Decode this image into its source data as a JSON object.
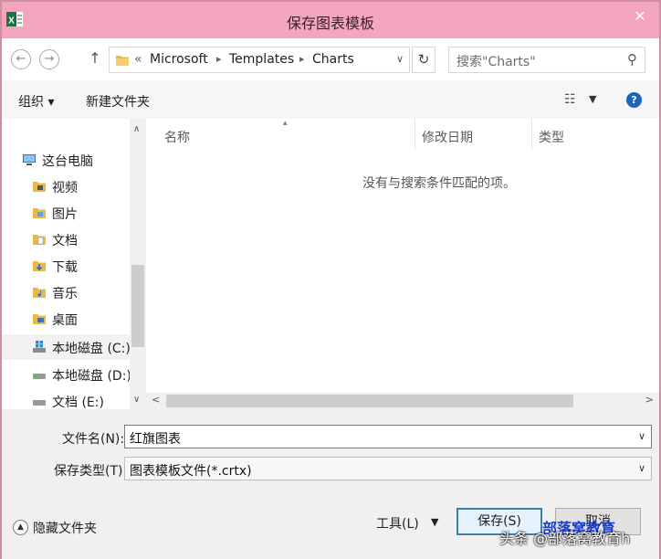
{
  "window": {
    "title": "保存图表模板",
    "close_glyph": "✕"
  },
  "nav": {
    "back_glyph": "←",
    "forward_glyph": "→",
    "up_glyph": "↑",
    "address_prefix": "«",
    "breadcrumb": [
      "Microsoft",
      "Templates",
      "Charts"
    ],
    "sep_glyph": "▸",
    "dropdown_glyph": "∨",
    "refresh_glyph": "↻",
    "search_placeholder": "搜索\"Charts\"",
    "search_glyph": "⚲"
  },
  "toolbar": {
    "organize_label": "组织 ▾",
    "new_folder_label": "新建文件夹",
    "view_glyph": "☷",
    "view_drop_glyph": "▼",
    "help_glyph": "?"
  },
  "sidebar": {
    "items": [
      {
        "label": "这台电脑",
        "icon": "computer-icon"
      },
      {
        "label": "视频",
        "icon": "folder-video-icon"
      },
      {
        "label": "图片",
        "icon": "folder-pictures-icon"
      },
      {
        "label": "文档",
        "icon": "folder-documents-icon"
      },
      {
        "label": "下载",
        "icon": "folder-downloads-icon"
      },
      {
        "label": "音乐",
        "icon": "folder-music-icon"
      },
      {
        "label": "桌面",
        "icon": "folder-desktop-icon"
      },
      {
        "label": "本地磁盘 (C:)",
        "icon": "windows-drive-icon"
      },
      {
        "label": "本地磁盘 (D:)",
        "icon": "drive-icon"
      },
      {
        "label": "文档 (E:)",
        "icon": "drive-icon"
      }
    ],
    "scroll_up_glyph": "∧",
    "scroll_down_glyph": "∨"
  },
  "file_list": {
    "columns": [
      "名称",
      "修改日期",
      "类型"
    ],
    "sort_glyph": "▴",
    "empty_message": "没有与搜索条件匹配的项。",
    "hscroll_left": "<",
    "hscroll_right": ">"
  },
  "form": {
    "filename_label": "文件名(N):",
    "filename_value": "红旗图表",
    "filetype_label": "保存类型(T):",
    "filetype_value": "图表模板文件(*.crtx)",
    "drop_glyph": "∨",
    "hide_folders_label": "隐藏文件夹",
    "hide_folders_glyph": "▲",
    "tools_label": "工具(L)",
    "tools_drop_glyph": "▼",
    "save_label": "保存(S)",
    "cancel_label": "取消"
  },
  "watermark": {
    "line1": "部落窝教育",
    "line2": "头条 @部落窝教育h"
  },
  "colors": {
    "titlebar": "#f3a6bd",
    "accent": "#3c7fb1",
    "folder": "#e8b84a",
    "excel_green": "#1f7244"
  }
}
